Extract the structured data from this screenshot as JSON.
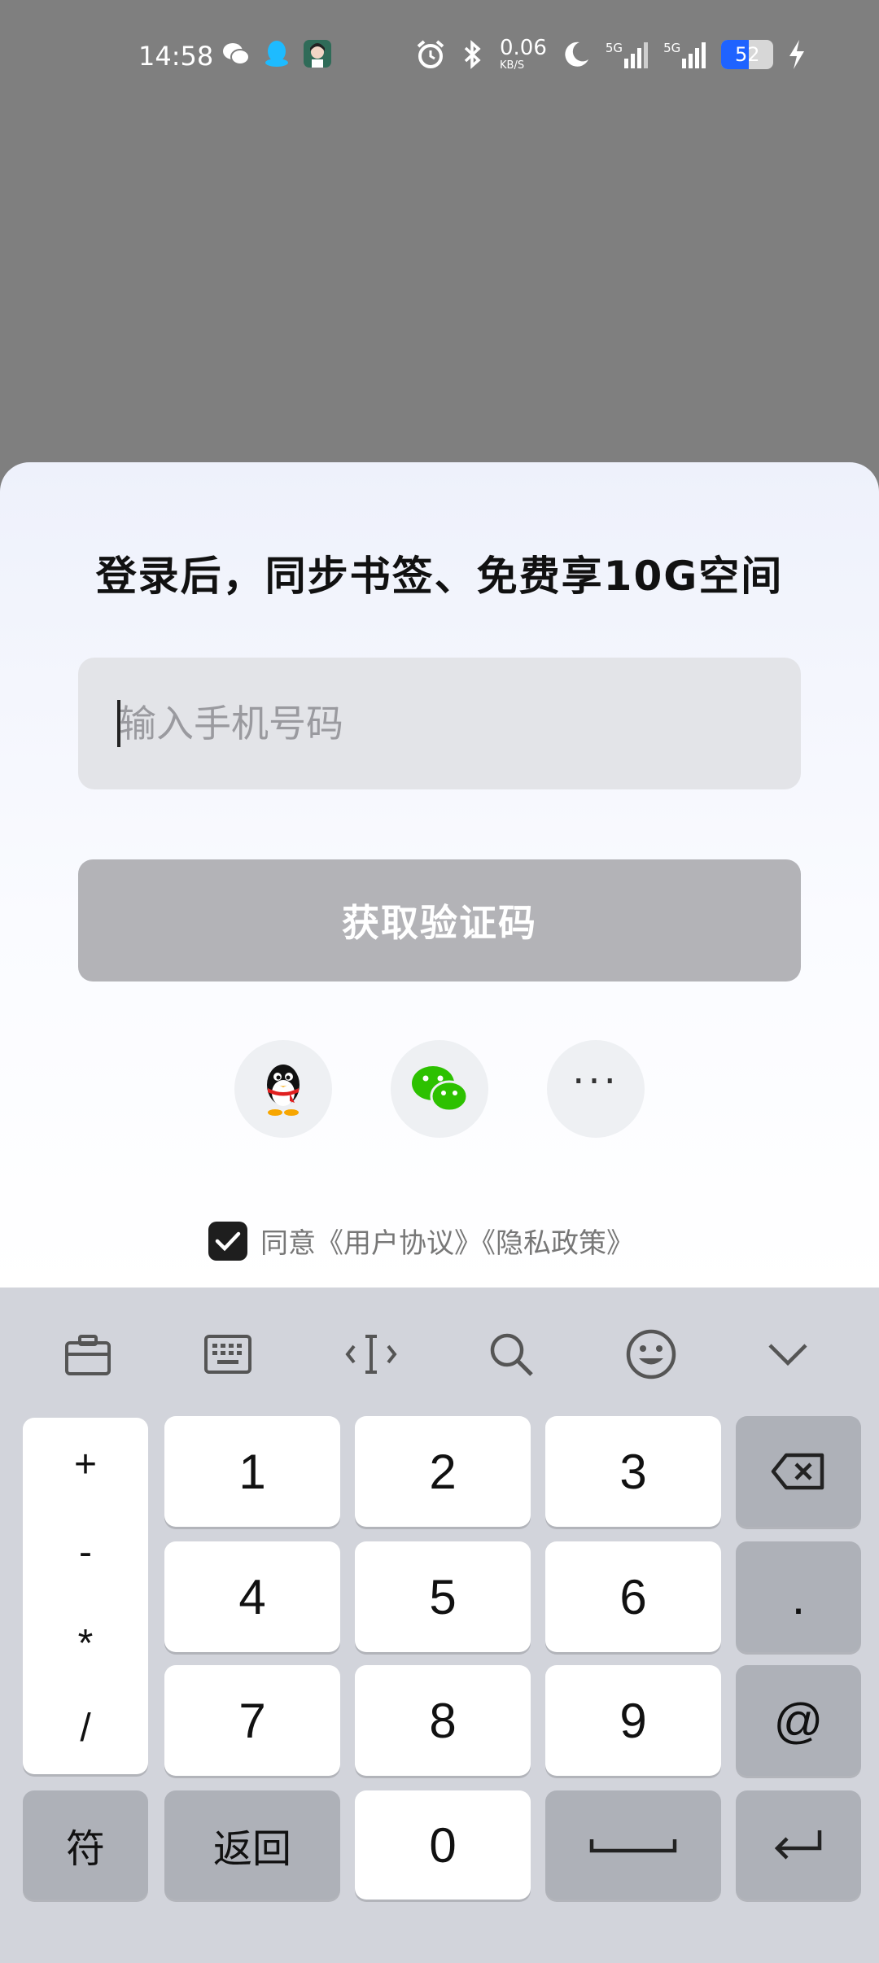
{
  "status_bar": {
    "time": "14:58",
    "speed_value": "0.06",
    "speed_unit": "KB/S",
    "net1": "5G",
    "net2": "5G",
    "battery": "52",
    "battery_level": 0.52
  },
  "login": {
    "headline": "登录后，同步书签、免费享10G空间",
    "phone_placeholder": "输入手机号码",
    "phone_value": "",
    "get_code_label": "获取验证码",
    "more_label": "···",
    "agree_text": "同意《用户协议》《隐私政策》",
    "agree_checked": true
  },
  "keyboard": {
    "symbols": [
      "+",
      "-",
      "*",
      "/"
    ],
    "rows": [
      [
        "1",
        "2",
        "3"
      ],
      [
        "4",
        "5",
        "6"
      ],
      [
        "7",
        "8",
        "9"
      ]
    ],
    "dot": ".",
    "at": "@",
    "sym_label": "符",
    "back_label": "返回",
    "zero": "0"
  },
  "icons": {
    "toolbar": [
      "clipboard-icon",
      "keyboard-icon",
      "text-cursor-icon",
      "search-icon",
      "emoji-icon",
      "collapse-icon"
    ],
    "accent": "#1f63ff",
    "wechat_green": "#2dc100"
  }
}
